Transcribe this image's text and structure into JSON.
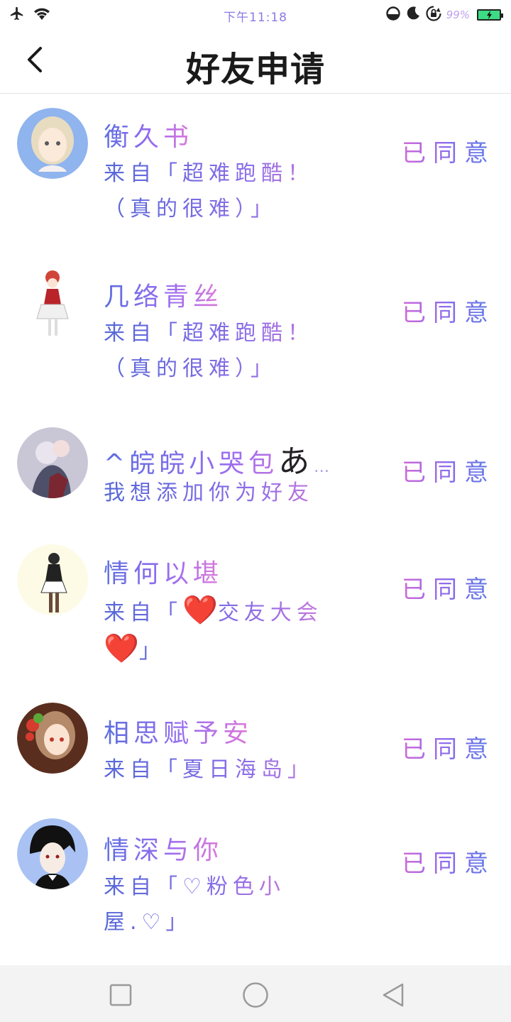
{
  "status_bar": {
    "time": "下午11:18",
    "battery_percent": "99%",
    "icons": [
      "airplane-icon",
      "wifi-icon",
      "data-saver-icon",
      "do-not-disturb-icon",
      "rotation-lock-icon",
      "battery-charging-icon"
    ]
  },
  "header": {
    "title": "好友申请"
  },
  "requests": [
    {
      "name": "衡久书",
      "source": "来自「超难跑酷！（真的很难）」",
      "status": "已同意"
    },
    {
      "name": "几络青丝",
      "source": "来自「超难跑酷！（真的很难）」",
      "status": "已同意"
    },
    {
      "name_prefix": "^皖皖小哭包",
      "name_suffix": "あ",
      "name_overflow": "…",
      "source": "我想添加你为好友",
      "status": "已同意"
    },
    {
      "name": "情何以堪",
      "source_prefix": "来自「",
      "source_emoji": "❤️",
      "source_middle": "交友大会",
      "source_suffix": "」",
      "status": "已同意"
    },
    {
      "name": "相思赋予安",
      "source": "来自「夏日海岛」",
      "status": "已同意"
    },
    {
      "name": "情深与你",
      "source": "来自「♡粉色小屋.♡」",
      "status": "已同意"
    }
  ],
  "colors": {
    "accent_gradient_start": "#5b6ee0",
    "accent_gradient_end": "#e07ad8",
    "nav_bg": "#f3f3f3",
    "battery": "#3ddc84"
  }
}
